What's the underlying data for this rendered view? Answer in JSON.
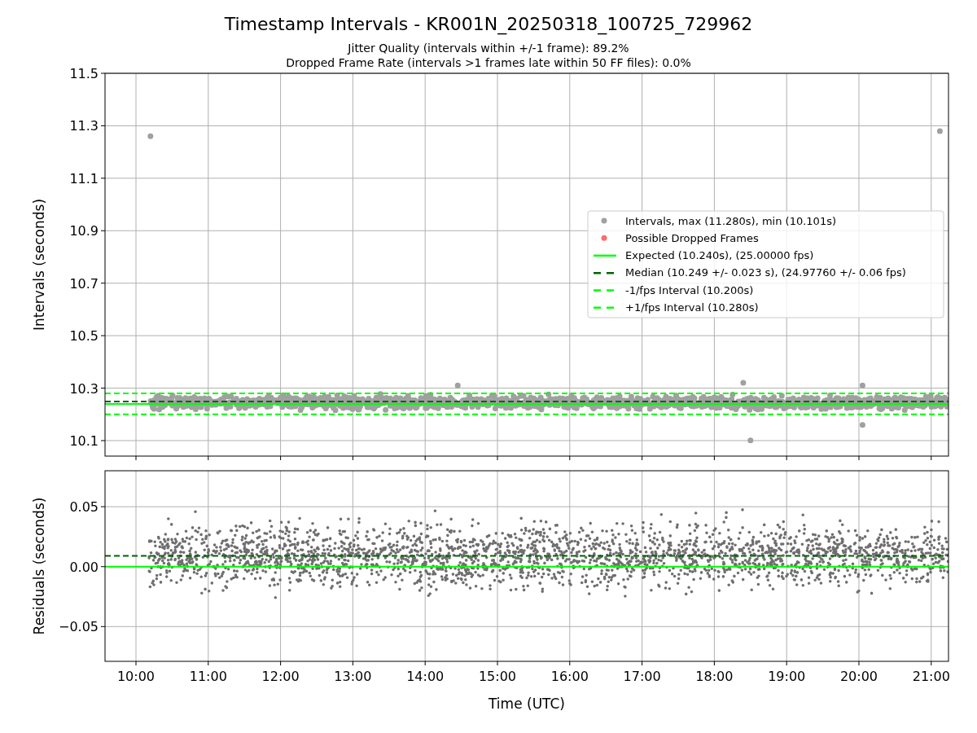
{
  "figure": {
    "title": "Timestamp Intervals - KR001N_20250318_100725_729962",
    "subtitles": [
      "Jitter Quality (intervals within +/-1 frame): 89.2%",
      "Dropped Frame Rate (intervals >1 frames late within 50 FF files): 0.0%"
    ]
  },
  "intervals_plot": {
    "chart_data": {
      "type": "line",
      "ylabel": "Intervals (seconds)",
      "grid": true,
      "x": [
        9.572,
        21.239
      ],
      "xlim": [
        9.572,
        21.239
      ],
      "ylim": [
        10.041,
        11.5
      ],
      "yticks": [
        {
          "value": 10.1,
          "label": "10.1"
        },
        {
          "value": 10.3,
          "label": "10.3"
        },
        {
          "value": 10.5,
          "label": "10.5"
        },
        {
          "value": 10.7,
          "label": "10.7"
        },
        {
          "value": 10.9,
          "label": "10.9"
        },
        {
          "value": 11.1,
          "label": "11.1"
        },
        {
          "value": 11.3,
          "label": "11.3"
        },
        {
          "value": 11.5,
          "label": "11.5"
        }
      ],
      "series": [
        {
          "color": "#00ff00",
          "line_style": "solid",
          "values": [
            10.24,
            10.24
          ]
        },
        {
          "color": "#006400",
          "line_style": "dashed",
          "values": [
            10.249,
            10.249
          ]
        },
        {
          "color": "#00ff00",
          "line_style": "dashed",
          "values": [
            10.2,
            10.2
          ]
        },
        {
          "color": "#00ff00",
          "line_style": "dashed",
          "values": [
            10.28,
            10.28
          ]
        }
      ]
    },
    "legend": [
      {
        "kind": "dot",
        "label": "Intervals, max (11.280s), min (10.101s)",
        "color": "#a0a0a0"
      },
      {
        "kind": "dot",
        "label": "Possible Dropped Frames",
        "color": "#ff6b6b"
      },
      {
        "kind": "solid",
        "label": "Expected (10.240s), (25.00000 fps)",
        "color": "#00ff00"
      },
      {
        "kind": "dashed",
        "label": "Median (10.249 +/- 0.023 s), (24.97760 +/- 0.06 fps)",
        "color": "#006400"
      },
      {
        "kind": "dashed",
        "label": "-1/fps Interval (10.200s)",
        "color": "#00ff00"
      },
      {
        "kind": "dashed",
        "label": "+1/fps Interval (10.280s)",
        "color": "#00ff00"
      }
    ]
  },
  "residuals_plot": {
    "chart_data": {
      "type": "line",
      "xlabel": "Time (UTC)",
      "ylabel": "Residuals (seconds)",
      "grid": true,
      "x": [
        9.572,
        21.239
      ],
      "xlim": [
        9.572,
        21.239
      ],
      "ylim": [
        -0.079,
        0.08
      ],
      "xticks": [
        {
          "value": 10,
          "label": "10:00"
        },
        {
          "value": 11,
          "label": "11:00"
        },
        {
          "value": 12,
          "label": "12:00"
        },
        {
          "value": 13,
          "label": "13:00"
        },
        {
          "value": 14,
          "label": "14:00"
        },
        {
          "value": 15,
          "label": "15:00"
        },
        {
          "value": 16,
          "label": "16:00"
        },
        {
          "value": 17,
          "label": "17:00"
        },
        {
          "value": 18,
          "label": "18:00"
        },
        {
          "value": 19,
          "label": "19:00"
        },
        {
          "value": 20,
          "label": "20:00"
        },
        {
          "value": 21,
          "label": "21:00"
        }
      ],
      "yticks": [
        {
          "value": -0.05,
          "label": "−0.05"
        },
        {
          "value": 0,
          "label": "0.00"
        },
        {
          "value": 0.05,
          "label": "0.05"
        }
      ],
      "series": [
        {
          "color": "#00ff00",
          "line_style": "solid",
          "values": [
            0,
            0
          ]
        },
        {
          "color": "#006400",
          "line_style": "dashed",
          "values": [
            0.009,
            0.009
          ]
        }
      ]
    }
  }
}
